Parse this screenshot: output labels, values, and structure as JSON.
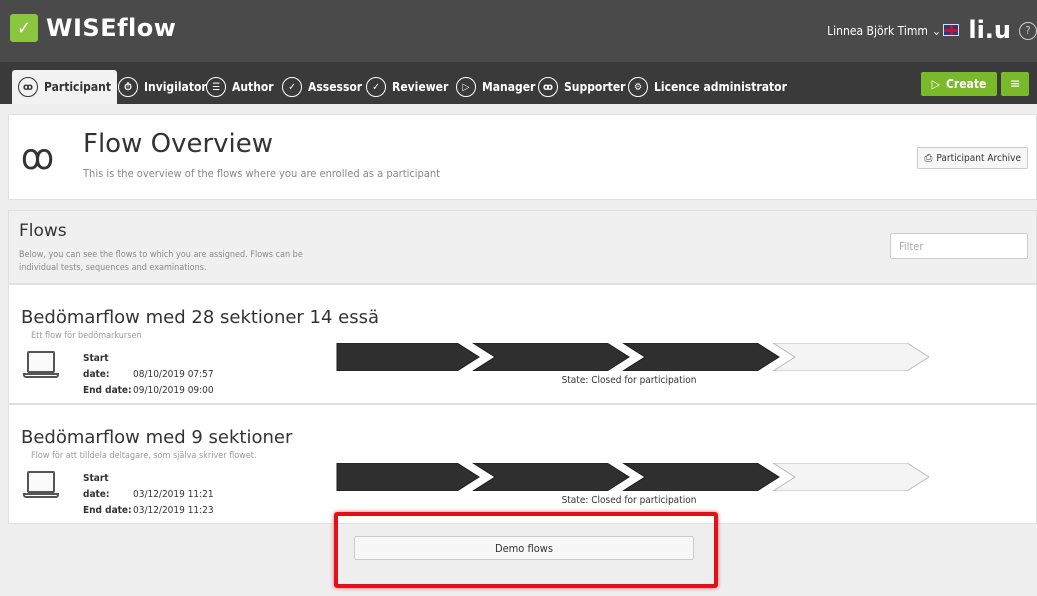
{
  "app": {
    "name": "WISEflow"
  },
  "user": {
    "name": "Linnea Björk Timm",
    "chevron": "⌄"
  },
  "university_logo": "li.u",
  "help": "?",
  "roles": [
    {
      "label": "Participant",
      "icon": "participant-icon",
      "glyph": "ꝏ"
    },
    {
      "label": "Invigilator",
      "icon": "stopwatch-icon",
      "glyph": "⏱"
    },
    {
      "label": "Author",
      "icon": "checklist-icon",
      "glyph": "☰"
    },
    {
      "label": "Assessor",
      "icon": "check-bubble-icon",
      "glyph": "✓"
    },
    {
      "label": "Reviewer",
      "icon": "review-bubbles-icon",
      "glyph": "✓"
    },
    {
      "label": "Manager",
      "icon": "flow-icon",
      "glyph": "▷"
    },
    {
      "label": "Supporter",
      "icon": "group-icon",
      "glyph": "ꝏ"
    },
    {
      "label": "Licence administrator",
      "icon": "gear-icon",
      "glyph": "⚙"
    }
  ],
  "create": {
    "label": "Create",
    "glyph": "▷"
  },
  "menu_glyph": "≡",
  "header": {
    "title": "Flow Overview",
    "subtitle": "This is the overview of the flows where you are enrolled as a participant",
    "archive_label": "Participant Archive",
    "icon_glyph": "ꝏ"
  },
  "flows": {
    "title": "Flows",
    "description": "Below, you can see the flows to which you are assigned. Flows can be individual tests, sequences and examinations.",
    "filter_placeholder": "Filter"
  },
  "flow_items": [
    {
      "name": "Bedömarflow med 28 sektioner 14 essä",
      "description": "Ett flow för bedömarkursen",
      "start_label": "Start date:",
      "start_date": "08/10/2019 07:57",
      "end_label": "End date:",
      "end_date": "09/10/2019 09:00",
      "state": "State: Closed for participation",
      "stages_completed": 3,
      "stages_total": 4
    },
    {
      "name": "Bedömarflow med 9 sektioner",
      "description": "Flow för att tilldela deltagare, som själva skriver flowet.",
      "start_label": "Start date:",
      "start_date": "03/12/2019 11:21",
      "end_label": "End date:",
      "end_date": "03/12/2019 11:23",
      "state": "State: Closed for participation",
      "stages_completed": 3,
      "stages_total": 4
    }
  ],
  "demo_button": "Demo flows",
  "colors": {
    "brand_green": "#7ab929",
    "highlight_red": "#e3101a",
    "chevron_dark": "#2f2f2f"
  }
}
